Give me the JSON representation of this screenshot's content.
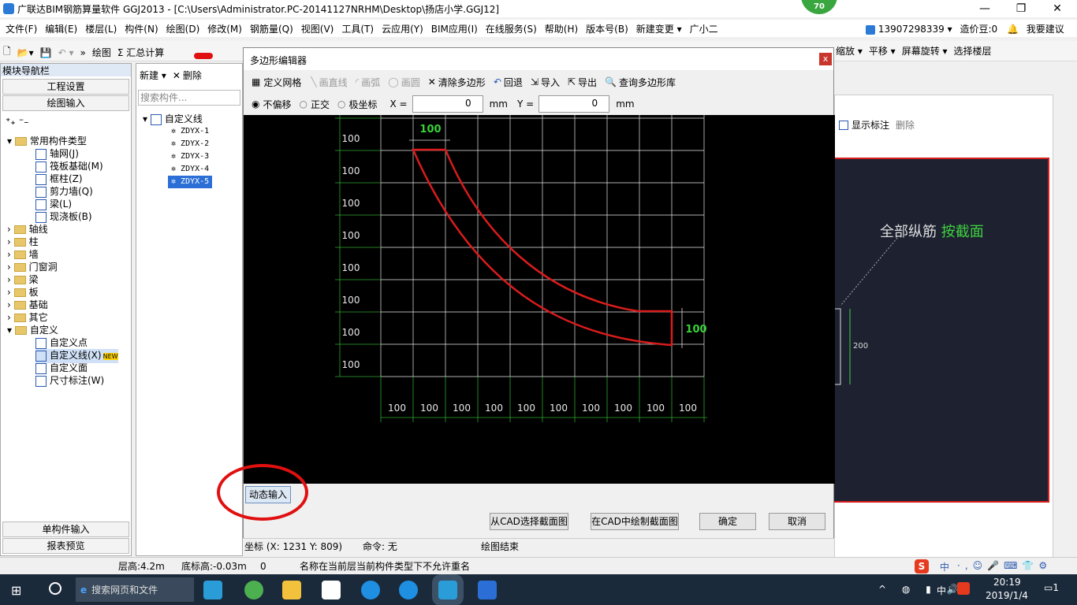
{
  "app": {
    "title": "广联达BIM钢筋算量软件 GGJ2013 - [C:\\Users\\Administrator.PC-20141127NRHM\\Desktop\\扬店小学.GGJ12]",
    "badge": "70",
    "window_controls": [
      "—",
      "❐",
      "✕"
    ]
  },
  "menubar": {
    "items": [
      "文件(F)",
      "编辑(E)",
      "楼层(L)",
      "构件(N)",
      "绘图(D)",
      "修改(M)",
      "钢筋量(Q)",
      "视图(V)",
      "工具(T)",
      "云应用(Y)",
      "BIM应用(I)",
      "在线服务(S)",
      "帮助(H)",
      "版本号(B)",
      "新建变更 ▾",
      "广小二"
    ],
    "phone": "13907298339",
    "cost_label": "造价豆:0",
    "suggest": "我要建议"
  },
  "toolbar": {
    "draw": "绘图",
    "sum": "Σ 汇总计算",
    "zoom": "缩放 ▾",
    "pan": "平移 ▾",
    "rotate": "屏幕旋转 ▾",
    "floors": "选择楼层"
  },
  "nav": {
    "header": "模块导航栏",
    "project": "工程设置",
    "draw_input": "绘图输入",
    "single_input": "单构件输入",
    "report": "报表预览",
    "group_common": "常用构件类型",
    "common_items": [
      "轴网(J)",
      "筏板基础(M)",
      "框柱(Z)",
      "剪力墙(Q)",
      "梁(L)",
      "现浇板(B)"
    ],
    "folders": [
      "轴线",
      "柱",
      "墙",
      "门窗洞",
      "梁",
      "板",
      "基础",
      "其它",
      "自定义"
    ],
    "custom_items": [
      "自定义点",
      "自定义线(X)",
      "自定义面",
      "尺寸标注(W)"
    ],
    "new_badge": "NEW"
  },
  "mid": {
    "new_btn": "新建 ▾",
    "delete_btn": "删除",
    "search_placeholder": "搜索构件...",
    "root": "自定义线",
    "items": [
      "ZDYX-1",
      "ZDYX-2",
      "ZDYX-3",
      "ZDYX-4",
      "ZDYX-5"
    ],
    "selected_index": 4
  },
  "right": {
    "show_label": "显示标注",
    "delete": "删除",
    "longbar": "全部纵筋",
    "by_section": "按截面",
    "dim": "200"
  },
  "dialog": {
    "title": "多边形编辑器",
    "close": "x",
    "tools": [
      "定义网格",
      "画直线",
      "画弧",
      "画圆",
      "清除多边形",
      "回退",
      "导入",
      "导出",
      "查询多边形库"
    ],
    "opts": [
      "不偏移",
      "正交",
      "极坐标"
    ],
    "x_label": "X =",
    "y_label": "Y =",
    "x_value": "0",
    "y_value": "0",
    "unit": "mm",
    "row_labels": [
      "100",
      "100",
      "100",
      "100",
      "100",
      "100",
      "100",
      "100"
    ],
    "col_labels": [
      "100",
      "100",
      "100",
      "100",
      "100",
      "100",
      "100",
      "100",
      "100",
      "100"
    ],
    "dim_top": "100",
    "dim_right": "100",
    "dynamic_input": "动态输入",
    "btn_cad_select": "从CAD选择截面图",
    "btn_cad_draw": "在CAD中绘制截面图",
    "btn_ok": "确定",
    "btn_cancel": "取消",
    "status_coord": "坐标 (X: 1231 Y: 809)",
    "status_cmd": "命令: 无",
    "status_state": "绘图结束"
  },
  "appstatus": {
    "floor_height": "层高:4.2m",
    "bottom_height": "底标高:-0.03m",
    "zero": "0",
    "message": "名称在当前层当前构件类型下不允许重名",
    "ime": "中"
  },
  "taskbar": {
    "search": "搜索网页和文件",
    "time": "20:19",
    "date": "2019/1/4",
    "lang": "中",
    "notif": "1"
  },
  "colors": {
    "accent_red": "#d91c1c",
    "grid_line": "#e8e8e8",
    "grid_green": "#2fa82f",
    "dim_green": "#39d339",
    "canvas_bg": "#000000"
  }
}
